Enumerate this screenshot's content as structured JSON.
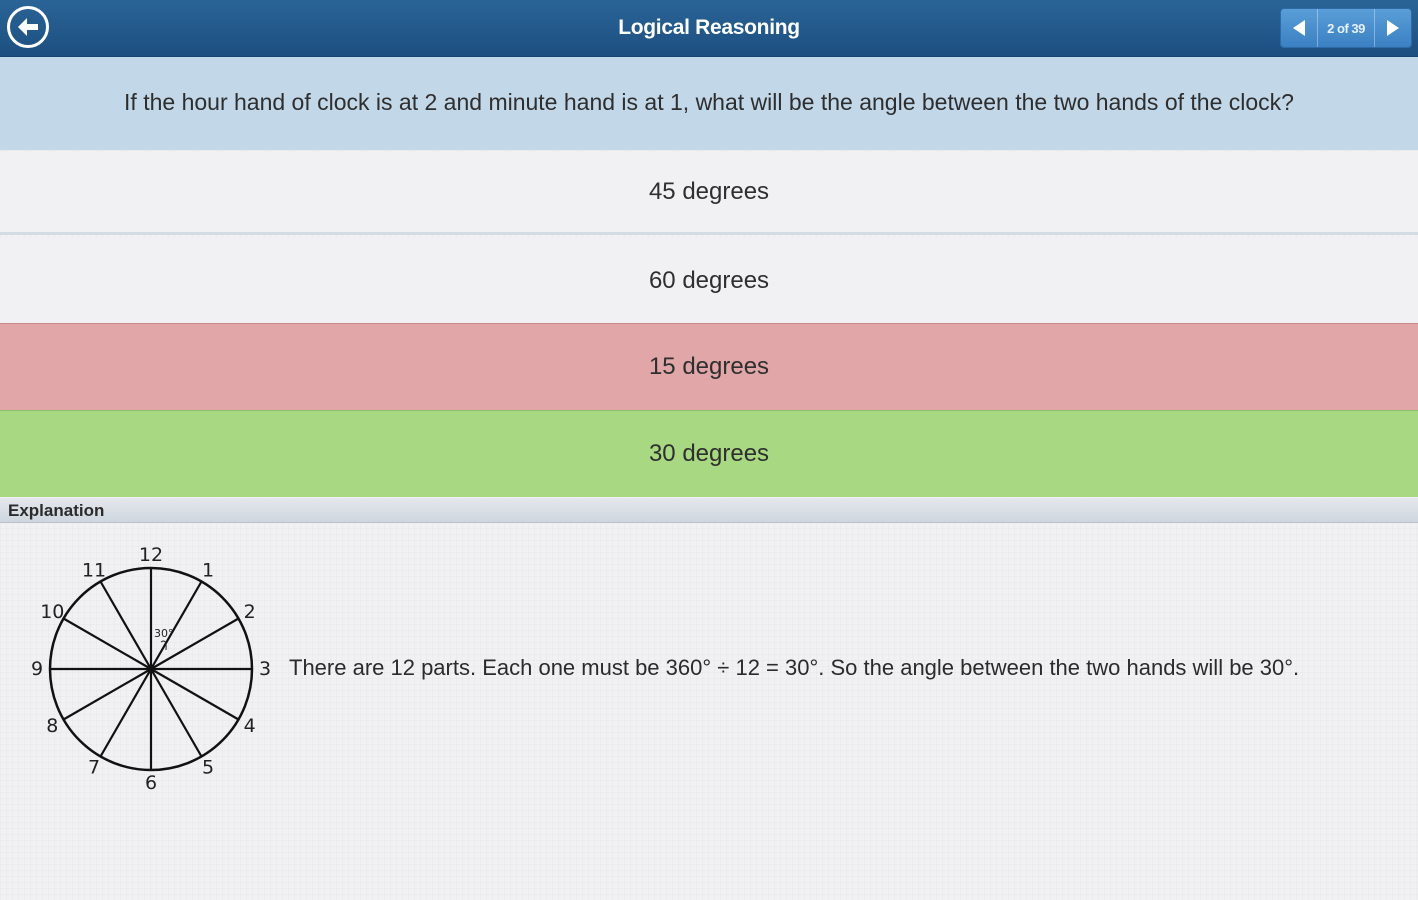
{
  "header": {
    "title": "Logical Reasoning",
    "back_icon": "arrow-left-circle-icon",
    "pager": {
      "label": "2 of 39",
      "prev_icon": "triangle-left-icon",
      "next_icon": "triangle-right-icon"
    }
  },
  "question": {
    "text": "If the hour hand of clock is at 2 and minute hand is at 1, what will be the angle between the two hands of the clock?"
  },
  "options": [
    {
      "label": "45 degrees",
      "state": "unselected"
    },
    {
      "label": "60 degrees",
      "state": "unselected"
    },
    {
      "label": "15 degrees",
      "state": "incorrect",
      "color": "#e0a6a8"
    },
    {
      "label": "30 degrees",
      "state": "correct",
      "color": "#a8d881"
    }
  ],
  "explanation": {
    "heading": "Explanation",
    "text": "There are 12 parts. Each one must be 360° ÷ 12 = 30°. So the angle between the two hands will be 30°.",
    "clock": {
      "numbers": [
        "12",
        "1",
        "2",
        "3",
        "4",
        "5",
        "6",
        "7",
        "8",
        "9",
        "10",
        "11"
      ],
      "angle_label": "30°"
    }
  },
  "colors": {
    "header": "#1d4f80",
    "question_bg": "#c2d7e8",
    "incorrect": "#e0a6a8",
    "correct": "#a8d881"
  }
}
